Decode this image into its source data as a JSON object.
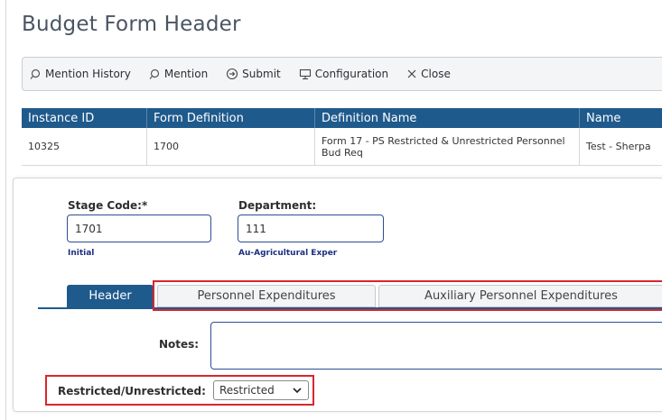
{
  "page": {
    "title": "Budget Form Header"
  },
  "toolbar": {
    "mention_history": "Mention History",
    "mention": "Mention",
    "submit": "Submit",
    "configuration": "Configuration",
    "close": "Close"
  },
  "grid": {
    "columns": [
      "Instance ID",
      "Form Definition",
      "Definition Name",
      "Name"
    ],
    "rows": [
      [
        "10325",
        "1700",
        "Form 17 - PS Restricted & Unrestricted Personnel Bud Req",
        "Test - Sherpa"
      ]
    ]
  },
  "form": {
    "stage_code": {
      "label": "Stage Code:*",
      "value": "1701",
      "hint": "Initial"
    },
    "department": {
      "label": "Department:",
      "value": "111",
      "hint": "Au-Agricultural Experiment Sta"
    },
    "tabs": [
      "Header",
      "Personnel Expenditures",
      "Auxiliary Personnel Expenditures"
    ],
    "notes": {
      "label": "Notes:",
      "value": ""
    },
    "restricted": {
      "label": "Restricted/Unrestricted:",
      "selected": "Restricted"
    }
  },
  "colors": {
    "accent": "#1f5a8c",
    "highlight": "#d9262c",
    "input_border": "#2d4e92",
    "hint_text": "#1b2f80"
  }
}
